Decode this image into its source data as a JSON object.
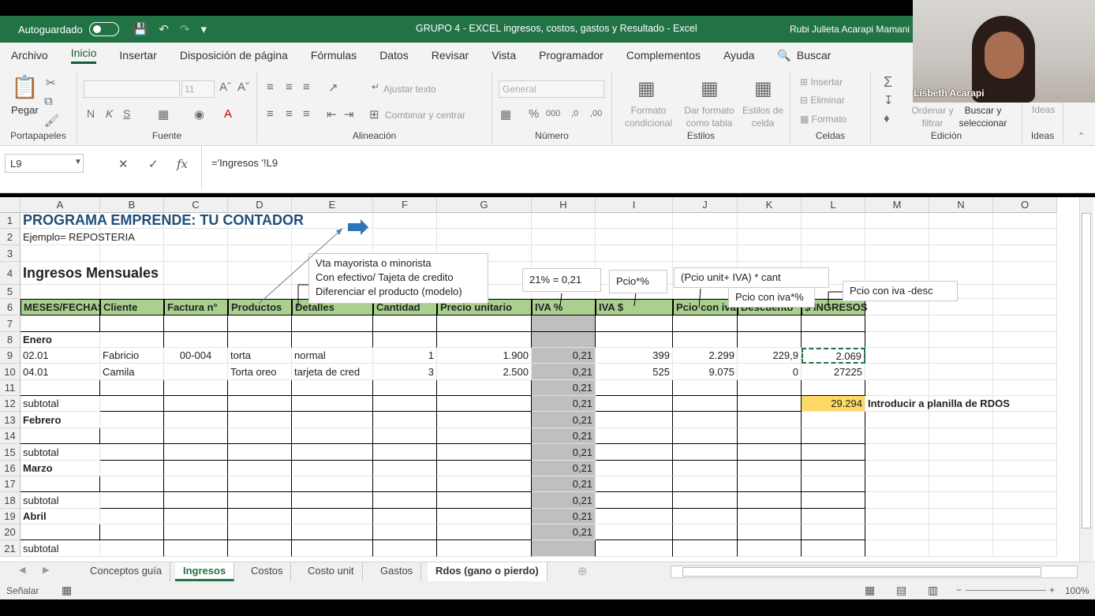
{
  "titlebar": {
    "autosave": "Autoguardado",
    "document": "GRUPO 4 - EXCEL ingresos, costos, gastos y Resultado  -  Excel",
    "user": "Rubi Julieta Acarapi Mamani"
  },
  "menu": [
    "Archivo",
    "Inicio",
    "Insertar",
    "Disposición de página",
    "Fórmulas",
    "Datos",
    "Revisar",
    "Vista",
    "Programador",
    "Complementos",
    "Ayuda",
    "Buscar"
  ],
  "ribbon": {
    "clipboard": {
      "paste": "Pegar",
      "group": "Portapapeles"
    },
    "font": {
      "name": "",
      "size": "11",
      "group": "Fuente",
      "bold": "N",
      "italic": "K",
      "underline": "S"
    },
    "alignment": {
      "wrap": "Ajustar texto",
      "merge": "Combinar y centrar",
      "group": "Alineación"
    },
    "number": {
      "format": "General",
      "group": "Número"
    },
    "styles": {
      "cond": "Formato condicional",
      "table": "Dar formato como tabla",
      "cell": "Estilos de celda",
      "group": "Estilos"
    },
    "cells": {
      "insert": "Insertar",
      "delete": "Eliminar",
      "format": "Formato",
      "group": "Celdas"
    },
    "editing": {
      "sort": "Ordenar y filtrar",
      "find": "Buscar y seleccionar",
      "group": "Edición"
    },
    "ideas": {
      "label": "Ideas",
      "group": "Ideas"
    }
  },
  "formula_bar": {
    "namebox": "L9",
    "formula": "='Ingresos '!L9"
  },
  "columns": [
    "A",
    "B",
    "C",
    "D",
    "E",
    "F",
    "G",
    "H",
    "I",
    "J",
    "K",
    "L",
    "M",
    "N",
    "O"
  ],
  "rows": [
    "1",
    "2",
    "3",
    "4",
    "5",
    "6",
    "7",
    "8",
    "9",
    "10",
    "11",
    "12",
    "13",
    "14",
    "15",
    "16",
    "17",
    "18",
    "19",
    "20",
    "21"
  ],
  "sheet": {
    "title": "PROGRAMA EMPRENDE: TU CONTADOR",
    "example": "Ejemplo= REPOSTERIA",
    "section": "Ingresos Mensuales",
    "headers": [
      "MESES/FECHAS",
      "Cliente",
      "Factura n°",
      "Productos",
      "Detalles",
      "Cantidad",
      "Precio unitario",
      "IVA %",
      "IVA $",
      "Pcio con iva",
      "Descuento",
      "$ INGRESOS"
    ],
    "month_enero": "Enero",
    "row9": [
      "02.01",
      "Fabricio",
      "00-004",
      "torta",
      "normal",
      "1",
      "1.900",
      "0,21",
      "399",
      "2.299",
      "229,9",
      "2.069"
    ],
    "row10": [
      "04.01",
      "Camila",
      "",
      "Torta oreo",
      "tarjeta de cred",
      "3",
      "2.500",
      "0,21",
      "525",
      "9.075",
      "0",
      "27225"
    ],
    "iva_rate": "0,21",
    "subtotal": "subtotal",
    "subtotal_value": "29.294",
    "rdos_note": "Introducir a planilla de RDOS",
    "month_febrero": "Febrero",
    "month_marzo": "Marzo",
    "month_abril": "Abril"
  },
  "notes": {
    "note1": [
      "Vta mayorista o minorista",
      "Con efectivo/ Tajeta de credito",
      "Diferenciar el producto (modelo)"
    ],
    "iva": "21% = 0,21",
    "pcio_pct": "Pcio*%",
    "pcio_unit": "(Pcio unit+ IVA) * cant",
    "pcio_iva": "Pcio con iva*%",
    "pcio_desc": "Pcio con iva -desc"
  },
  "tabs": [
    "Conceptos guía",
    "Ingresos",
    "Costos",
    "Costo unit",
    "Gastos",
    "Rdos (gano o pierdo)"
  ],
  "status": {
    "mode": "Señalar",
    "zoom": "100%"
  },
  "video": {
    "name": "Lisbeth Acarapi"
  },
  "colors": {
    "excel_green": "#217346",
    "header_fill": "#a9d08e",
    "subtotal_fill": "#ffd966",
    "title_blue": "#1f4e79"
  }
}
